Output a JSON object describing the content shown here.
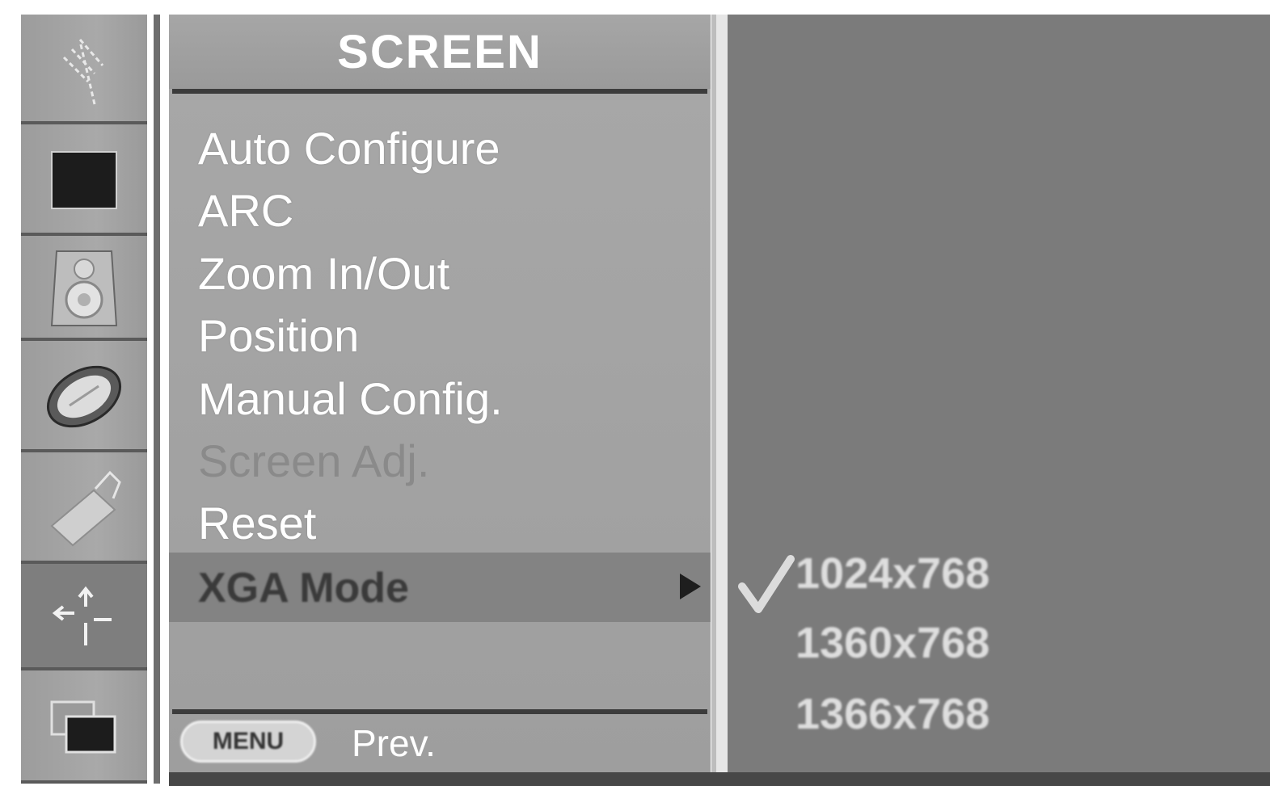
{
  "menu": {
    "title": "SCREEN",
    "items": [
      {
        "label": "Auto Configure",
        "enabled": true
      },
      {
        "label": "ARC",
        "enabled": true
      },
      {
        "label": "Zoom In/Out",
        "enabled": true
      },
      {
        "label": "Position",
        "enabled": true
      },
      {
        "label": "Manual Config.",
        "enabled": true
      },
      {
        "label": "Screen Adj.",
        "enabled": false
      },
      {
        "label": "Reset",
        "enabled": true
      },
      {
        "label": "XGA Mode",
        "enabled": true,
        "selected": true
      }
    ]
  },
  "footer": {
    "menu_button_label": "MENU",
    "prev_label": "Prev."
  },
  "sidebar": {
    "items": [
      {
        "icon": "antenna-icon"
      },
      {
        "icon": "picture-icon"
      },
      {
        "icon": "speaker-icon"
      },
      {
        "icon": "disc-icon"
      },
      {
        "icon": "option-icon"
      },
      {
        "icon": "screen-adjust-icon",
        "active": true
      },
      {
        "icon": "pip-icon"
      }
    ]
  },
  "submenu": {
    "items": [
      {
        "label": "1024x768",
        "checked": true
      },
      {
        "label": "1360x768",
        "checked": false
      },
      {
        "label": "1366x768",
        "checked": false
      }
    ]
  },
  "colors": {
    "menu_bg": "#a5a5a5",
    "submenu_bg": "#7b7b7b",
    "highlight_bg": "#838383",
    "text": "#ffffff",
    "disabled_text": "#8a8a8a"
  }
}
